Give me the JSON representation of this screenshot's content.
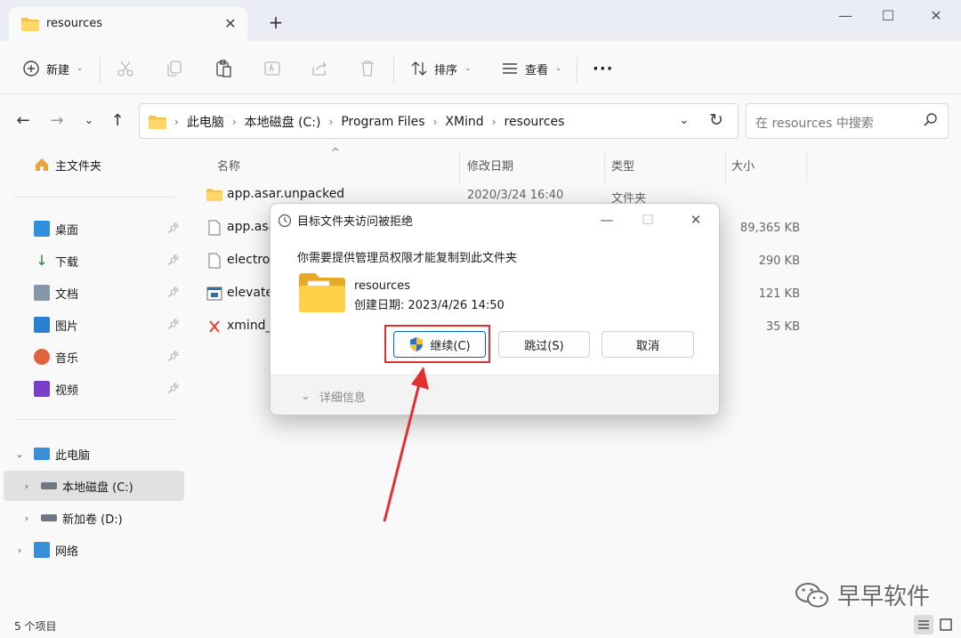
{
  "tab": {
    "title": "resources",
    "close": "✕",
    "new_tab": "+"
  },
  "window_controls": {
    "minimize": "—",
    "maximize": "☐",
    "close": "✕"
  },
  "toolbar": {
    "new_label": "新建",
    "sort_label": "排序",
    "view_label": "查看",
    "more_label": "···"
  },
  "address": {
    "crumbs": [
      "此电脑",
      "本地磁盘 (C:)",
      "Program Files",
      "XMind",
      "resources"
    ],
    "separator": "›",
    "search_placeholder": "在 resources 中搜索"
  },
  "sidebar": {
    "home": "主文件夹",
    "quick": [
      {
        "label": "桌面",
        "icon": "desktop-icon",
        "color": "#2f8fd8"
      },
      {
        "label": "下载",
        "icon": "download-icon",
        "color": "#1f8a3b"
      },
      {
        "label": "文档",
        "icon": "document-icon",
        "color": "#6a7a8c"
      },
      {
        "label": "图片",
        "icon": "picture-icon",
        "color": "#2a80d0"
      },
      {
        "label": "音乐",
        "icon": "music-icon",
        "color": "#e0643c"
      },
      {
        "label": "视频",
        "icon": "video-icon",
        "color": "#7a3fc8"
      }
    ],
    "this_pc": "此电脑",
    "drive_c": "本地磁盘 (C:)",
    "drive_d": "新加卷 (D:)",
    "network": "网络"
  },
  "columns": {
    "name": "名称",
    "modified": "修改日期",
    "type": "类型",
    "size": "大小"
  },
  "files": [
    {
      "name": "app.asar.unpacked",
      "modified": "2020/3/24 16:40",
      "type": "文件夹",
      "size": "",
      "icon": "folder-icon"
    },
    {
      "name": "app.asa",
      "modified": "",
      "type": "",
      "size": "89,365 KB",
      "icon": "file-icon"
    },
    {
      "name": "electron",
      "modified": "",
      "type": "",
      "size": "290 KB",
      "icon": "file-icon"
    },
    {
      "name": "elevate",
      "modified": "",
      "type": "",
      "size": "121 KB",
      "icon": "exe-icon"
    },
    {
      "name": "xmind_",
      "modified": "",
      "type": "",
      "size": "35 KB",
      "icon": "xmind-icon"
    }
  ],
  "status": {
    "count": "5 个项目"
  },
  "dialog": {
    "title": "目标文件夹访问被拒绝",
    "message": "你需要提供管理员权限才能复制到此文件夹",
    "folder_name": "resources",
    "folder_date": "创建日期: 2023/4/26 14:50",
    "continue_label": "继续(C)",
    "skip_label": "跳过(S)",
    "cancel_label": "取消",
    "details_label": "详细信息"
  },
  "watermark": {
    "text": "早早软件"
  },
  "colors": {
    "accent": "#0067c0",
    "highlight": "#e03030",
    "folder": "#f5c04a"
  }
}
